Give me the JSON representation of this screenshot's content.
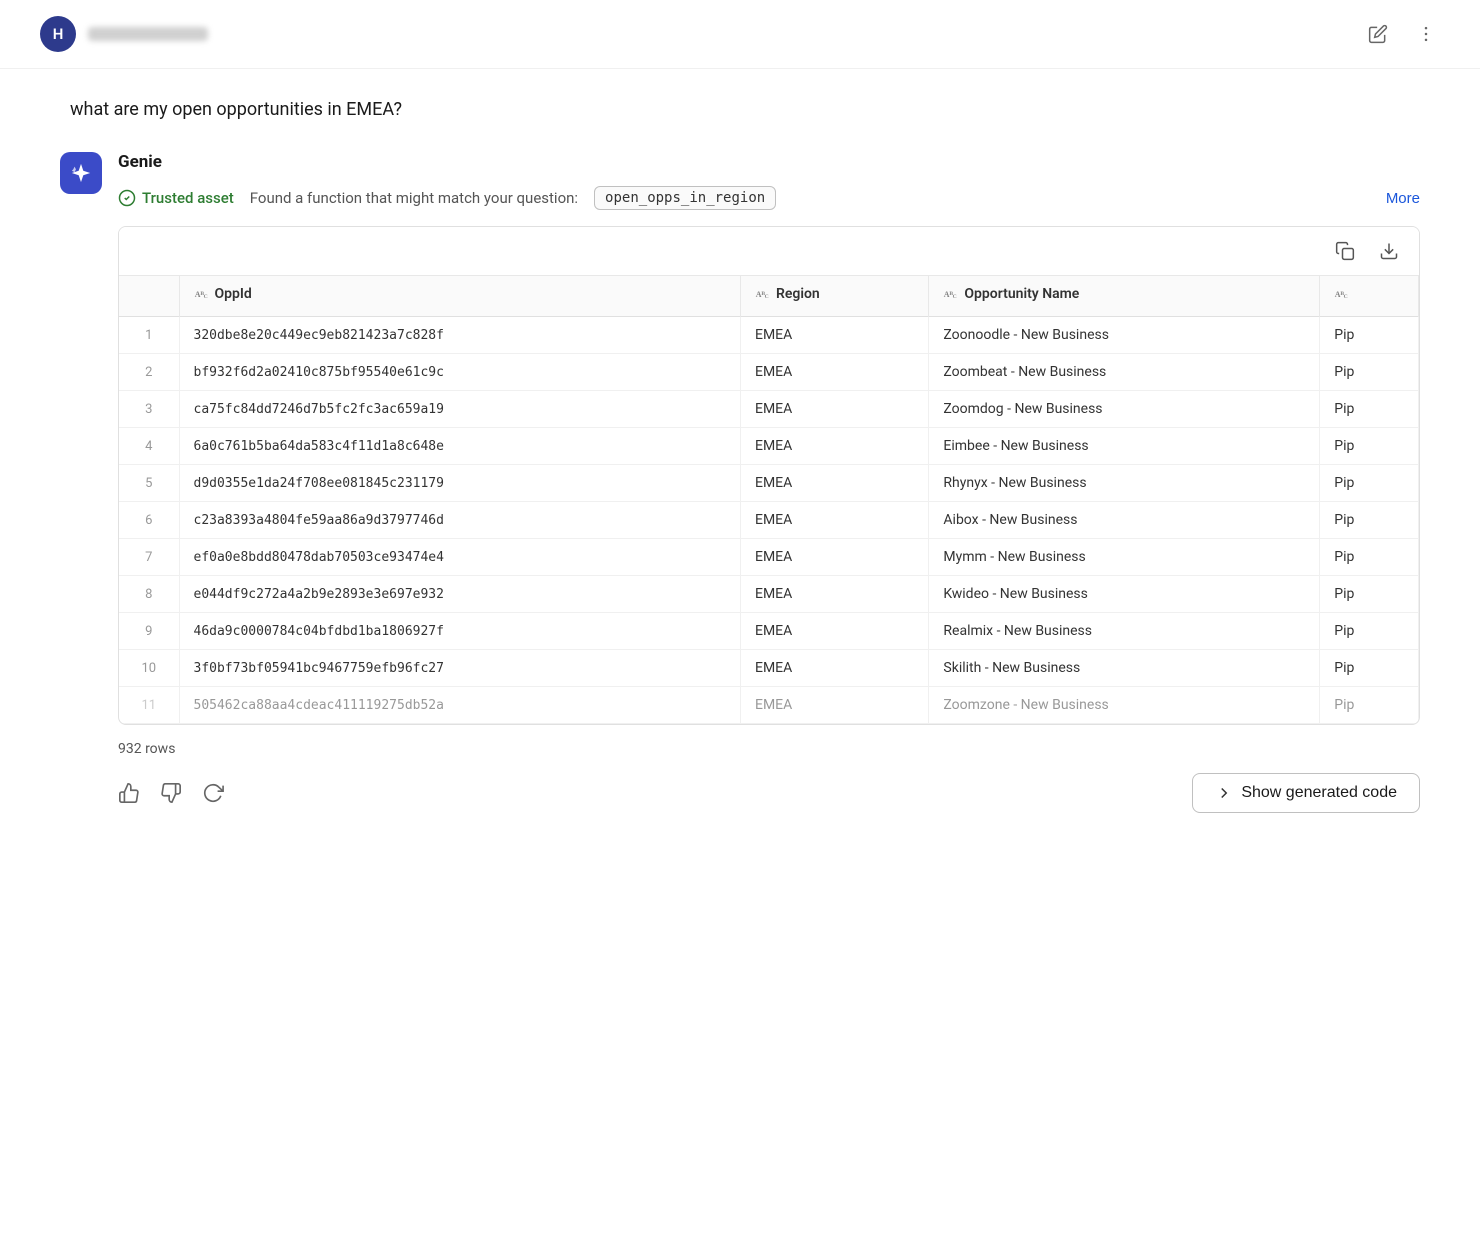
{
  "header": {
    "user_initial": "H",
    "edit_icon": "edit-icon",
    "more_icon": "more-vertical-icon"
  },
  "user_message": {
    "text": "what are my open opportunities in EMEA?"
  },
  "genie": {
    "name": "Genie",
    "trusted_asset_label": "Trusted asset",
    "found_function_text": "Found a function that might match your question:",
    "function_name": "open_opps_in_region",
    "more_label": "More"
  },
  "table": {
    "copy_icon": "copy-icon",
    "download_icon": "download-icon",
    "columns": [
      {
        "name": "",
        "type": ""
      },
      {
        "name": "OppId",
        "type": "abc"
      },
      {
        "name": "Region",
        "type": "abc"
      },
      {
        "name": "Opportunity Name",
        "type": "abc"
      },
      {
        "name": "...",
        "type": "abc"
      }
    ],
    "rows": [
      {
        "num": "1",
        "opp_id": "320dbe8e20c449ec9eb821423a7c828f",
        "region": "EMEA",
        "opp_name": "Zoonoodle - New Business",
        "extra": "Pip"
      },
      {
        "num": "2",
        "opp_id": "bf932f6d2a02410c875bf95540e61c9c",
        "region": "EMEA",
        "opp_name": "Zoombeat - New Business",
        "extra": "Pip"
      },
      {
        "num": "3",
        "opp_id": "ca75fc84dd7246d7b5fc2fc3ac659a19",
        "region": "EMEA",
        "opp_name": "Zoomdog - New Business",
        "extra": "Pip"
      },
      {
        "num": "4",
        "opp_id": "6a0c761b5ba64da583c4f11d1a8c648e",
        "region": "EMEA",
        "opp_name": "Eimbee - New Business",
        "extra": "Pip"
      },
      {
        "num": "5",
        "opp_id": "d9d0355e1da24f708ee081845c231179",
        "region": "EMEA",
        "opp_name": "Rhynyx - New Business",
        "extra": "Pip"
      },
      {
        "num": "6",
        "opp_id": "c23a8393a4804fe59aa86a9d3797746d",
        "region": "EMEA",
        "opp_name": "Aibox - New Business",
        "extra": "Pip"
      },
      {
        "num": "7",
        "opp_id": "ef0a0e8bdd80478dab70503ce93474e4",
        "region": "EMEA",
        "opp_name": "Mymm - New Business",
        "extra": "Pip"
      },
      {
        "num": "8",
        "opp_id": "e044df9c272a4a2b9e2893e3e697e932",
        "region": "EMEA",
        "opp_name": "Kwideo - New Business",
        "extra": "Pip"
      },
      {
        "num": "9",
        "opp_id": "46da9c0000784c04bfdbd1ba1806927f",
        "region": "EMEA",
        "opp_name": "Realmix - New Business",
        "extra": "Pip"
      },
      {
        "num": "10",
        "opp_id": "3f0bf73bf05941bc9467759efb96fc27",
        "region": "EMEA",
        "opp_name": "Skilith - New Business",
        "extra": "Pip"
      },
      {
        "num": "11",
        "opp_id": "505462ca88aa4cdeac411119275db52a",
        "region": "EMEA",
        "opp_name": "Zoomzone - New Business",
        "extra": "Pip"
      }
    ],
    "row_count": "932 rows"
  },
  "actions": {
    "thumbs_up_icon": "thumbs-up-icon",
    "thumbs_down_icon": "thumbs-down-icon",
    "refresh_icon": "refresh-icon",
    "show_code_button": "Show generated code",
    "chevron_icon": "chevron-right-icon"
  }
}
